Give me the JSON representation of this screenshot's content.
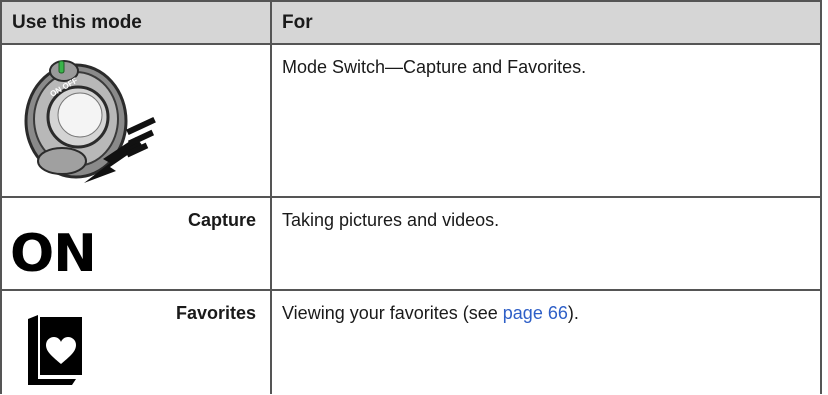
{
  "table": {
    "header": {
      "col1": "Use this mode",
      "col2": "For"
    },
    "rows": [
      {
        "mode": "",
        "icon": "mode-switch-dial-icon",
        "description": "Mode Switch—Capture and Favorites."
      },
      {
        "mode": "Capture",
        "icon": "on-text-icon",
        "icon_text": "ON",
        "description": "Taking pictures and videos."
      },
      {
        "mode": "Favorites",
        "icon": "favorites-heart-icon",
        "description_before": "Viewing your favorites (see ",
        "link": "page 66",
        "description_after": ")."
      }
    ]
  }
}
